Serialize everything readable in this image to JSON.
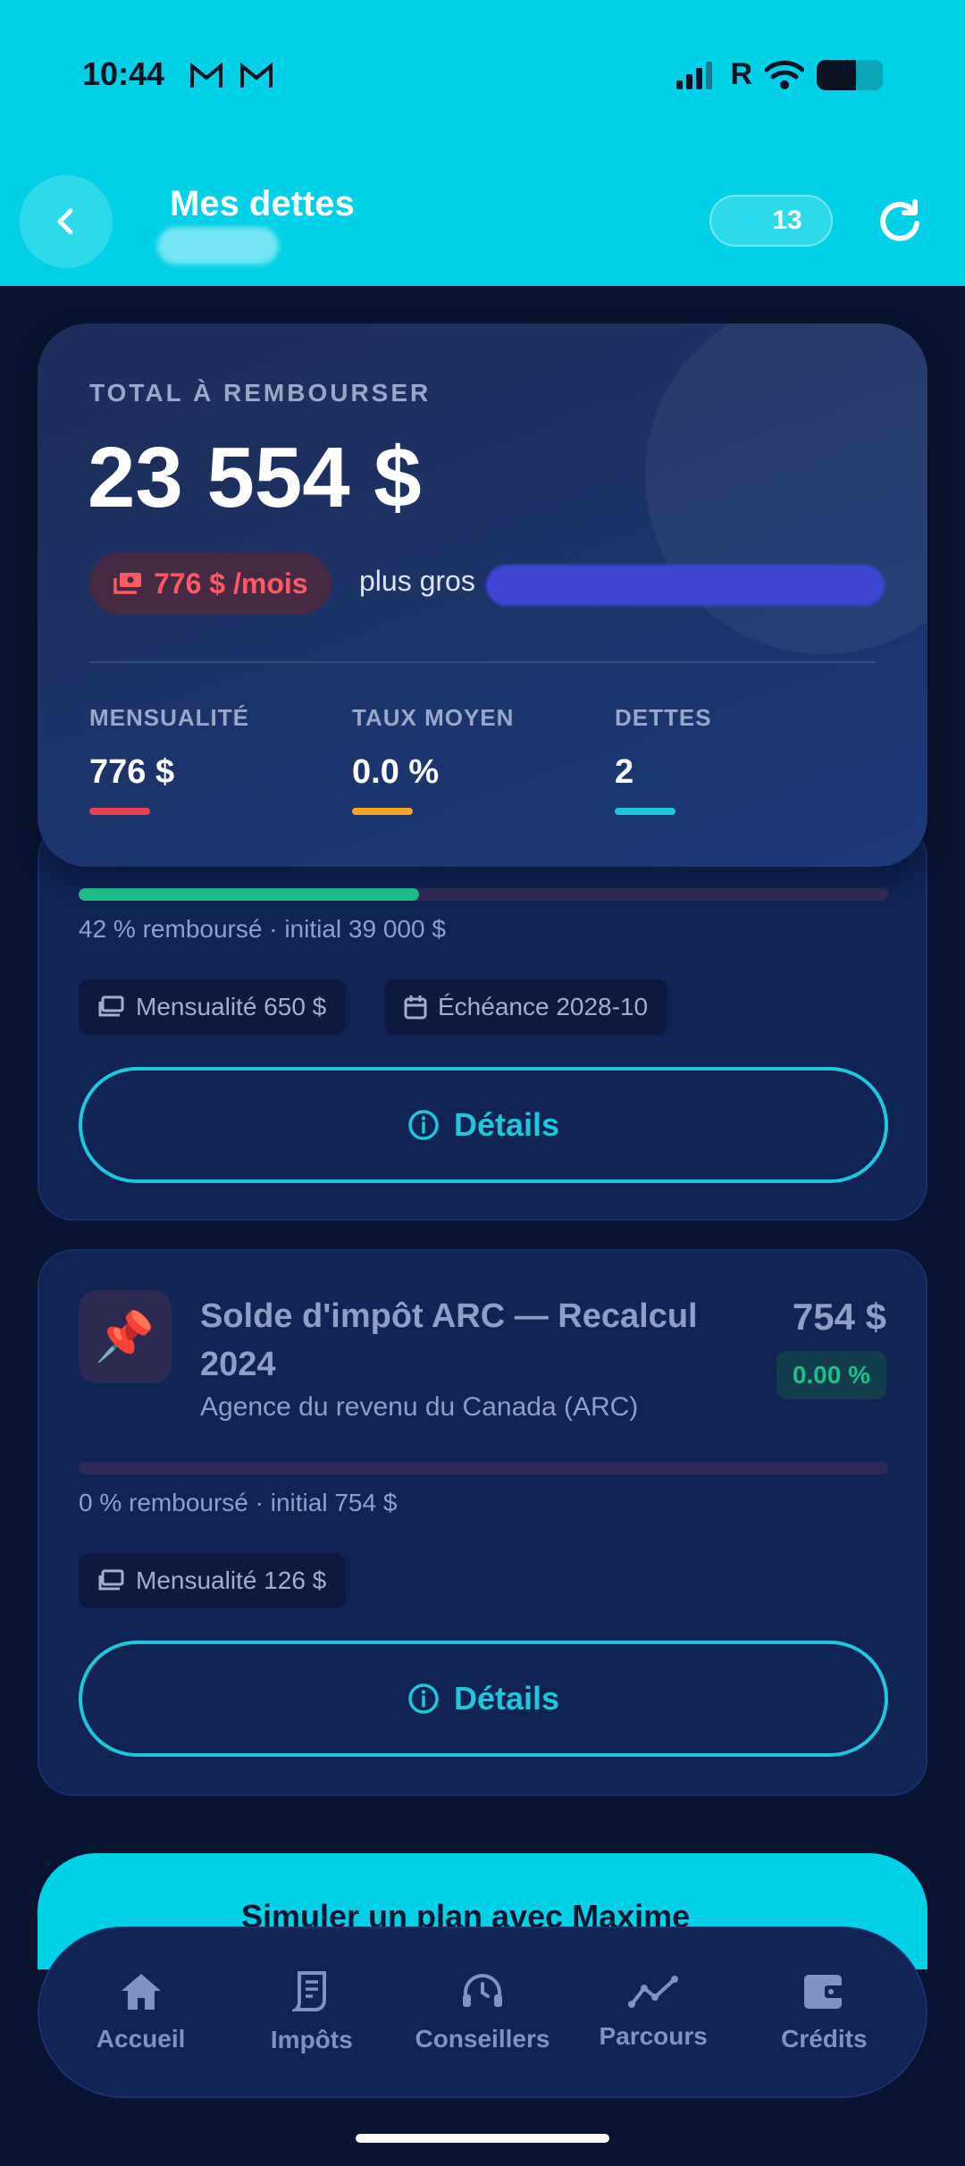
{
  "status_bar": {
    "time": "10:44",
    "carrier_badge": "R"
  },
  "header": {
    "title": "Mes dettes",
    "points": "13"
  },
  "summary": {
    "label": "TOTAL À REMBOURSER",
    "total": "23 554 $",
    "monthly_pill": "776 $ /mois",
    "largest_prefix": "plus gros",
    "stats": [
      {
        "label": "MENSUALITÉ",
        "value": "776 $",
        "color": "#e8414f"
      },
      {
        "label": "TAUX MOYEN",
        "value": "0.0 %",
        "color": "#f5a524"
      },
      {
        "label": "DETTES",
        "value": "2",
        "color": "#1ec7dc"
      }
    ]
  },
  "debts": [
    {
      "progress_fraction": 0.42,
      "progress_text": "42 % remboursé · initial 39 000 $",
      "chips": [
        "Mensualité 650 $",
        "Échéance 2028-10"
      ],
      "details_label": "Détails"
    },
    {
      "icon": "📌",
      "name": "Solde d'impôt ARC — Recalcul 2024",
      "creditor": "Agence du revenu du Canada (ARC)",
      "amount": "754 $",
      "rate": "0.00 %",
      "progress_fraction": 0.0,
      "progress_text": "0 % remboursé · initial 754 $",
      "chips": [
        "Mensualité 126 $"
      ],
      "details_label": "Détails"
    }
  ],
  "cta": {
    "label": "Simuler un plan avec Maxime"
  },
  "nav": [
    {
      "label": "Accueil",
      "icon": "home-icon"
    },
    {
      "label": "Impôts",
      "icon": "receipt-icon"
    },
    {
      "label": "Conseillers",
      "icon": "headset-icon"
    },
    {
      "label": "Parcours",
      "icon": "chart-line-icon"
    },
    {
      "label": "Crédits",
      "icon": "wallet-icon"
    }
  ]
}
